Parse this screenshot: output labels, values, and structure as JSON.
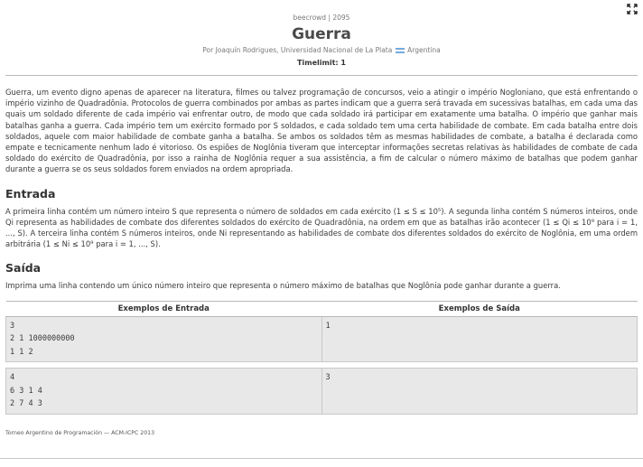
{
  "header": {
    "source": "beecrowd | 2095",
    "title": "Guerra",
    "author_prefix": "Por Joaquín Rodrigues, Universidad Nacional de La Plata",
    "country": "Argentina",
    "timelimit": "Timelimit: 1"
  },
  "description": "Guerra, um evento digno apenas de aparecer na literatura, filmes ou talvez programação de concursos, veio a atingir o império Nogloniano, que está enfrentando o império vizinho de Quadradônia. Protocolos de guerra combinados por ambas as partes indicam que a guerra será travada em sucessivas batalhas, em cada uma das quais um soldado diferente de cada império vai enfrentar outro, de modo que cada soldado irá participar em exatamente uma batalha. O império que ganhar mais batalhas ganha a guerra. Cada império tem um exército formado por S soldados, e cada soldado tem uma certa habilidade de combate. Em cada batalha entre dois soldados, aquele com maior habilidade de combate ganha a batalha. Se ambos os soldados têm as mesmas habilidades de combate, a batalha é declarada como empate e tecnicamente nenhum lado é vitorioso. Os espiões de Noglônia tiveram que interceptar informações secretas relativas às habilidades de combate de cada soldado do exército de Quadradônia, por isso a rainha de Noglônia requer a sua assistência, a fim de calcular o número máximo de batalhas que podem ganhar durante a guerra se os seus soldados forem enviados na ordem apropriada.",
  "input_section": {
    "heading": "Entrada",
    "text": "A primeira linha contém um número inteiro S que representa o número de soldados em cada exército (1 ≤ S ≤ 10⁵). A segunda linha contém S números inteiros, onde Qi representa as habilidades de combate dos diferentes soldados do exército de Quadradônia, na ordem em que as batalhas irão acontecer (1 ≤ Qi ≤ 10⁹ para i = 1, ..., S). A terceira linha contém S números inteiros, onde Ni representando as habilidades de combate dos diferentes soldados do exército de Noglônia, em uma ordem arbitrária (1 ≤ Ni ≤ 10⁹ para i = 1, ..., S)."
  },
  "output_section": {
    "heading": "Saída",
    "text": "Imprima uma linha contendo um único número inteiro que representa o número máximo de batalhas que Noglônia pode ganhar durante a guerra."
  },
  "examples": {
    "input_header": "Exemplos de Entrada",
    "output_header": "Exemplos de Saída",
    "cases": [
      {
        "input": "3\n2 1 1000000000\n1 1 2",
        "output": "1"
      },
      {
        "input": "4\n6 3 1 4\n2 7 4 3",
        "output": "3"
      }
    ]
  },
  "footer": "Torneo Argentino de Programación — ACM-ICPC 2013",
  "icons": {
    "expand": "expand-icon",
    "flag": "argentina-flag-icon"
  }
}
